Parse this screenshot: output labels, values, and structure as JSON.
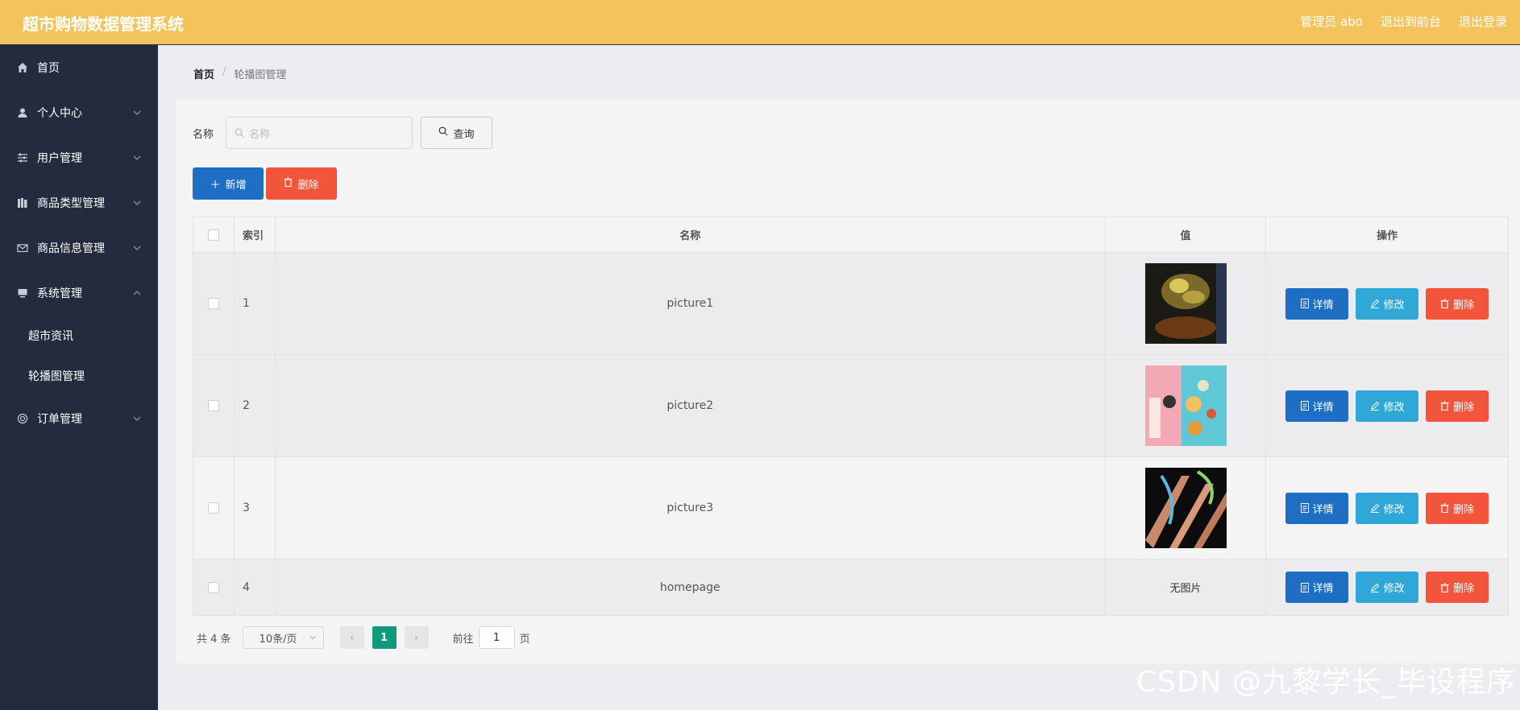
{
  "header": {
    "title": "超市购物数据管理系统",
    "admin": "管理员 abo",
    "to_front": "退出到前台",
    "logout": "退出登录"
  },
  "sidebar": {
    "items": [
      {
        "label": "首页",
        "icon": "home-icon"
      },
      {
        "label": "个人中心",
        "icon": "user-icon"
      },
      {
        "label": "用户管理",
        "icon": "sliders-icon"
      },
      {
        "label": "商品类型管理",
        "icon": "books-icon"
      },
      {
        "label": "商品信息管理",
        "icon": "mail-icon"
      },
      {
        "label": "系统管理",
        "icon": "monitor-icon"
      },
      {
        "label": "订单管理",
        "icon": "circle-icon"
      }
    ],
    "sub_items": [
      {
        "label": "超市资讯"
      },
      {
        "label": "轮播图管理"
      }
    ]
  },
  "breadcrumb": {
    "home": "首页",
    "sep": "/",
    "current": "轮播图管理"
  },
  "search": {
    "label": "名称",
    "placeholder": "名称",
    "button": "查询"
  },
  "toolbar": {
    "add": "新增",
    "delete": "删除"
  },
  "table": {
    "headers": {
      "index": "索引",
      "name": "名称",
      "value": "值",
      "ops": "操作"
    },
    "rows": [
      {
        "index": "1",
        "name": "picture1",
        "value": ""
      },
      {
        "index": "2",
        "name": "picture2",
        "value": ""
      },
      {
        "index": "3",
        "name": "picture3",
        "value": ""
      },
      {
        "index": "4",
        "name": "homepage",
        "value": "无图片"
      }
    ],
    "ops": {
      "detail": "详情",
      "edit": "修改",
      "delete": "删除"
    }
  },
  "pagination": {
    "total": "共 4 条",
    "page_size": "10条/页",
    "current": "1",
    "goto_prefix": "前往",
    "goto_value": "1",
    "goto_suffix": "页"
  },
  "watermark": "CSDN @九黎学长_毕设程序"
}
